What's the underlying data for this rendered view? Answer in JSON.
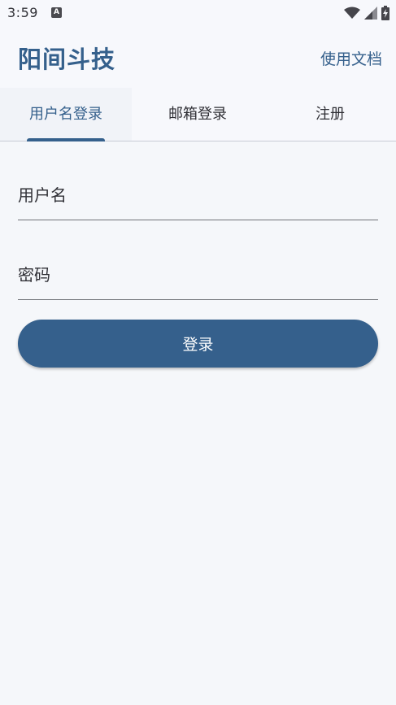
{
  "status_bar": {
    "time": "3:59",
    "notification_icon": "a-icon",
    "wifi_icon": "wifi-icon",
    "signal_icon": "signal-icon",
    "battery_icon": "battery-charging-icon"
  },
  "header": {
    "title": "阳间斗技",
    "docs_link": "使用文档"
  },
  "tabs": [
    {
      "label": "用户名登录",
      "active": true
    },
    {
      "label": "邮箱登录",
      "active": false
    },
    {
      "label": "注册",
      "active": false
    }
  ],
  "form": {
    "username_placeholder": "用户名",
    "username_value": "",
    "password_placeholder": "密码",
    "password_value": "",
    "submit_label": "登录"
  },
  "colors": {
    "primary": "#35608c",
    "background": "#f5f7fa",
    "header_bg": "#f7f8fc",
    "text": "#303036",
    "divider": "#c8ccd4"
  }
}
